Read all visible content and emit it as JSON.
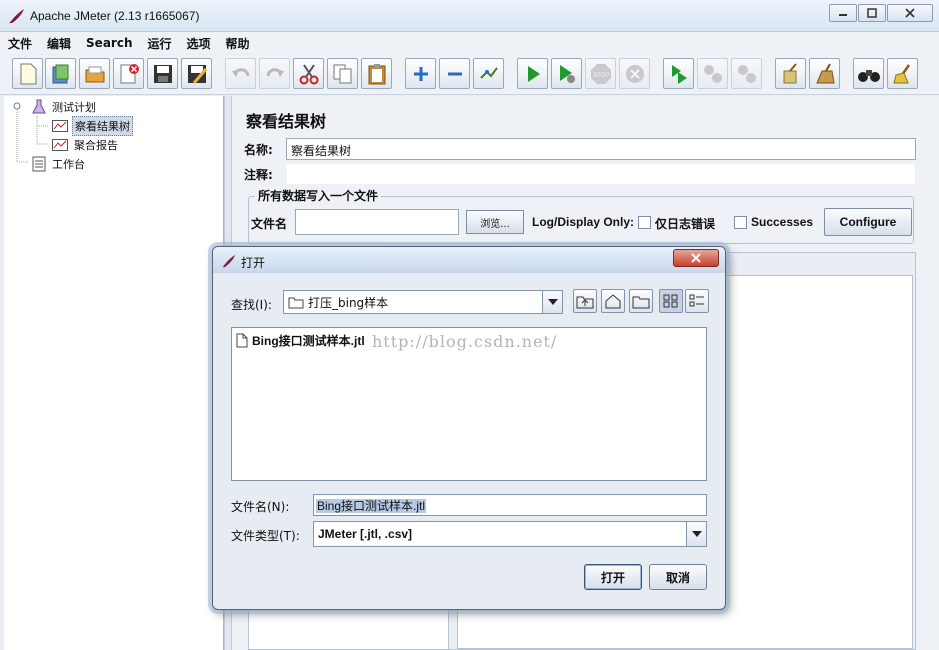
{
  "window": {
    "title": "Apache JMeter (2.13 r1665067)"
  },
  "menu": [
    "文件",
    "编辑",
    "Search",
    "运行",
    "选项",
    "帮助"
  ],
  "toolbar": {
    "icons": [
      "new-icon",
      "templates-icon",
      "open-icon",
      "close-icon",
      "save-icon",
      "save-as-icon",
      "undo-icon",
      "redo-icon",
      "cut-icon",
      "copy-icon",
      "paste-icon",
      "expand-icon",
      "collapse-icon",
      "toggle-icon",
      "start-icon",
      "start-no-pause-icon",
      "stop-icon",
      "shutdown-icon",
      "remote-start-icon",
      "remote-stop-icon",
      "remote-shutdown-icon",
      "clear-icon",
      "clear-all-icon",
      "search-icon",
      "reset-search-icon"
    ]
  },
  "tree": {
    "items": [
      {
        "label": "测试计划",
        "icon": "test-plan-icon"
      },
      {
        "label": "察看结果树",
        "icon": "listener-icon"
      },
      {
        "label": "聚合报告",
        "icon": "listener-icon"
      },
      {
        "label": "工作台",
        "icon": "workbench-icon"
      }
    ]
  },
  "panel": {
    "title": "察看结果树",
    "name_label": "名称:",
    "name_value": "察看结果树",
    "comment_label": "注释:",
    "comment_value": "",
    "group_legend": "所有数据写入一个文件",
    "filename_label": "文件名",
    "filename_value": "",
    "browse_label": "浏览...",
    "log_display_label": "Log/Display Only:",
    "errors_label": "仅日志错误",
    "successes_label": "Successes",
    "configure_label": "Configure"
  },
  "dialog": {
    "title": "打开",
    "look_in_label": "查找(I):",
    "look_in_value": "打压_bing样本",
    "files": [
      "Bing接口测试样本.jtl"
    ],
    "watermark": "http://blog.csdn.net/",
    "filename_label": "文件名(N):",
    "filename_value": "Bing接口测试样本.jtl",
    "filetype_label": "文件类型(T):",
    "filetype_value": "JMeter [.jtl, .csv]",
    "open_label": "打开",
    "cancel_label": "取消"
  },
  "colors": {
    "window_bg": "#eef2f7",
    "dialog_close": "#c8412f",
    "selection": "#b5c9e3"
  }
}
